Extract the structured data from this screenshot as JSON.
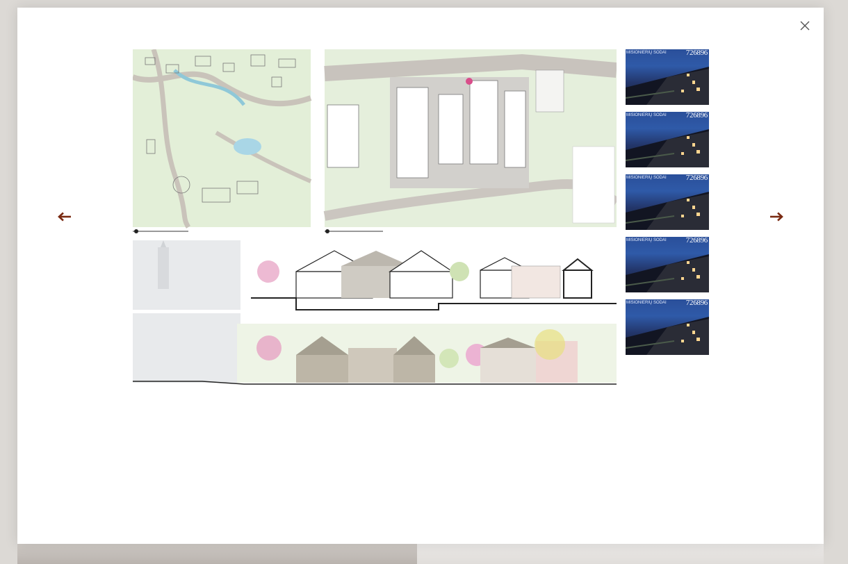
{
  "lightbox": {
    "close_icon": "close-icon",
    "prev_icon": "arrow-left-icon",
    "next_icon": "arrow-right-icon",
    "arrow_color": "#7a2a12"
  },
  "thumbnails": [
    {
      "header": "MISIONIERIŲ SODAI",
      "number": "726896"
    },
    {
      "header": "MISIONIERIŲ SODAI",
      "number": "726896"
    },
    {
      "header": "MISIONIERIŲ SODAI",
      "number": "726896"
    },
    {
      "header": "MISIONIERIŲ SODAI",
      "number": "726896"
    },
    {
      "header": "MISIONIERIŲ SODAI",
      "number": "726896"
    }
  ]
}
